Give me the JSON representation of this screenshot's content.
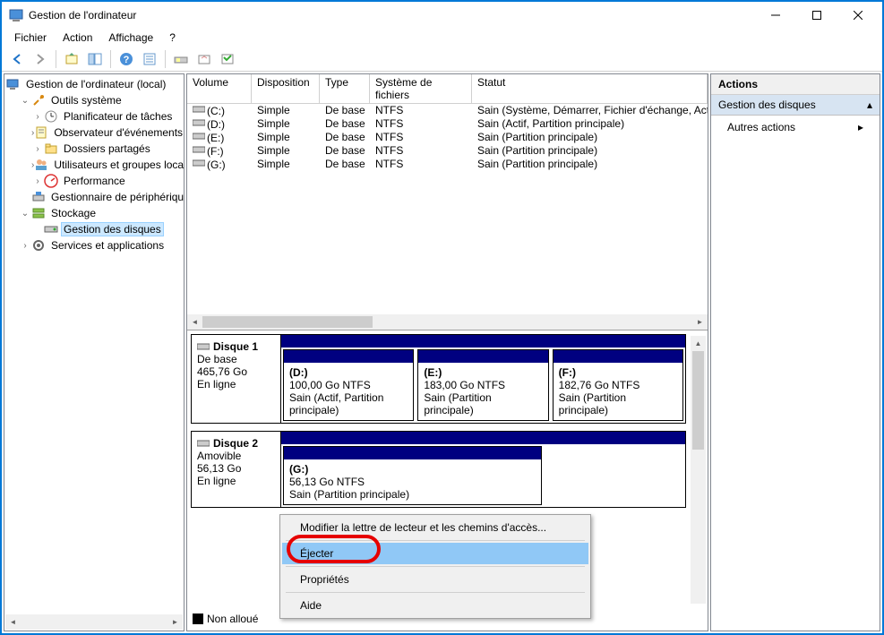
{
  "window": {
    "title": "Gestion de l'ordinateur"
  },
  "menu": {
    "file": "Fichier",
    "action": "Action",
    "view": "Affichage",
    "help": "?"
  },
  "tree": {
    "root": "Gestion de l'ordinateur (local)",
    "system_tools": "Outils système",
    "task_scheduler": "Planificateur de tâches",
    "event_viewer": "Observateur d'événements",
    "shared_folders": "Dossiers partagés",
    "local_users": "Utilisateurs et groupes locaux",
    "performance": "Performance",
    "device_manager": "Gestionnaire de périphériques",
    "storage": "Stockage",
    "disk_management": "Gestion des disques",
    "services": "Services et applications"
  },
  "columns": {
    "volume": "Volume",
    "layout": "Disposition",
    "type": "Type",
    "filesystem": "Système de fichiers",
    "status": "Statut"
  },
  "volumes": [
    {
      "name": "(C:)",
      "layout": "Simple",
      "type": "De base",
      "fs": "NTFS",
      "status": "Sain (Système, Démarrer, Fichier d'échange, Actif, Vidage sur incident)"
    },
    {
      "name": "(D:)",
      "layout": "Simple",
      "type": "De base",
      "fs": "NTFS",
      "status": "Sain (Actif, Partition principale)"
    },
    {
      "name": "(E:)",
      "layout": "Simple",
      "type": "De base",
      "fs": "NTFS",
      "status": "Sain (Partition principale)"
    },
    {
      "name": "(F:)",
      "layout": "Simple",
      "type": "De base",
      "fs": "NTFS",
      "status": "Sain (Partition principale)"
    },
    {
      "name": "(G:)",
      "layout": "Simple",
      "type": "De base",
      "fs": "NTFS",
      "status": "Sain (Partition principale)"
    }
  ],
  "disks": [
    {
      "name": "Disque 1",
      "type": "De base",
      "size": "465,76 Go",
      "state": "En ligne",
      "parts": [
        {
          "letter": "(D:)",
          "info": "100,00 Go NTFS",
          "status": "Sain (Actif, Partition principale)"
        },
        {
          "letter": "(E:)",
          "info": "183,00 Go NTFS",
          "status": "Sain (Partition principale)"
        },
        {
          "letter": "(F:)",
          "info": "182,76 Go NTFS",
          "status": "Sain (Partition principale)"
        }
      ]
    },
    {
      "name": "Disque 2",
      "type": "Amovible",
      "size": "56,13 Go",
      "state": "En ligne",
      "parts": [
        {
          "letter": "(G:)",
          "info": "56,13 Go NTFS",
          "status": "Sain (Partition principale)"
        }
      ]
    }
  ],
  "legend": {
    "unallocated": "Non alloué"
  },
  "actions_panel": {
    "header": "Actions",
    "section": "Gestion des disques",
    "other": "Autres actions"
  },
  "context_menu": {
    "change_letter": "Modifier la lettre de lecteur et les chemins d'accès...",
    "eject": "Éjecter",
    "properties": "Propriétés",
    "help": "Aide"
  }
}
